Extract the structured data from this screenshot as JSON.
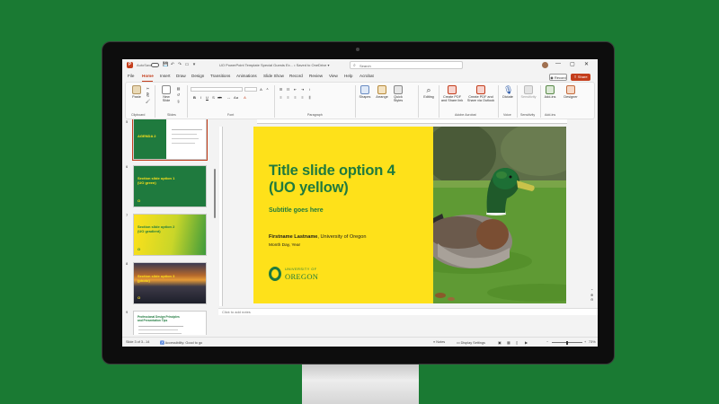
{
  "titlebar": {
    "autosave": "AutoSave",
    "filename": "UO PowerPoint Template Special Guests Ex...  •  Saved to OneDrive ▾",
    "search_placeholder": "Search",
    "minimize": "—",
    "maximize": "▢",
    "close": "✕"
  },
  "menu": {
    "tabs": [
      "File",
      "Home",
      "Insert",
      "Draw",
      "Design",
      "Transitions",
      "Animations",
      "Slide Show",
      "Record",
      "Review",
      "View",
      "Help",
      "Acrobat"
    ],
    "active": "Home",
    "record": "Record",
    "share": "Share"
  },
  "ribbon": {
    "paste": "Paste",
    "new_slide": "New\nSlide",
    "groups": {
      "clipboard": "Clipboard",
      "slides": "Slides",
      "font": "Font",
      "paragraph": "Paragraph",
      "adobe": "Adobe Acrobat",
      "voice": "Voice",
      "sensitivity": "Sensitivity",
      "addins": "Add-ins"
    },
    "shapes": "Shapes",
    "arrange": "Arrange",
    "quick_styles": "Quick\nStyles",
    "editing": "Editing",
    "create_pdf": "Create PDF\nand Share link",
    "create_pdf_outlook": "Create PDF and\nShare via Outlook",
    "dictate": "Dictate",
    "sensitivity": "Sensitivity",
    "addins": "Add-ins",
    "designer": "Designer"
  },
  "thumbnails": [
    {
      "num": "5",
      "title": "AGENDA 2",
      "style": "agenda"
    },
    {
      "num": "6",
      "title": "Section slide option 1\n(UO green)",
      "style": "green"
    },
    {
      "num": "7",
      "title": "Section slide option 2\n(UO gradient)",
      "style": "gradient"
    },
    {
      "num": "8",
      "title": "Section slide option 3\n(photo)",
      "style": "photo"
    },
    {
      "num": "9",
      "title": "Professional Design Principles\nand Presentation Tips",
      "style": "white"
    }
  ],
  "slide": {
    "title_line1": "Title slide option 4",
    "title_line2": "(UO yellow)",
    "subtitle": "Subtitle goes here",
    "presenter_name": "Firstname Lastname",
    "presenter_org": ", University of Oregon",
    "date": "Month Day, Year",
    "logo_line1": "UNIVERSITY OF",
    "logo_line2": "OREGON"
  },
  "notes_placeholder": "Click to add notes",
  "statusbar": {
    "slide_count": "Slide 3 of 3...14",
    "accessibility": "Accessibility: Good to go",
    "notes": "Notes",
    "display_settings": "Display Settings",
    "zoom": "73%"
  },
  "colors": {
    "uo_green": "#1f7a3e",
    "uo_yellow": "#fee11a",
    "ppt_accent": "#c43e1c",
    "background": "#1a7a33"
  }
}
